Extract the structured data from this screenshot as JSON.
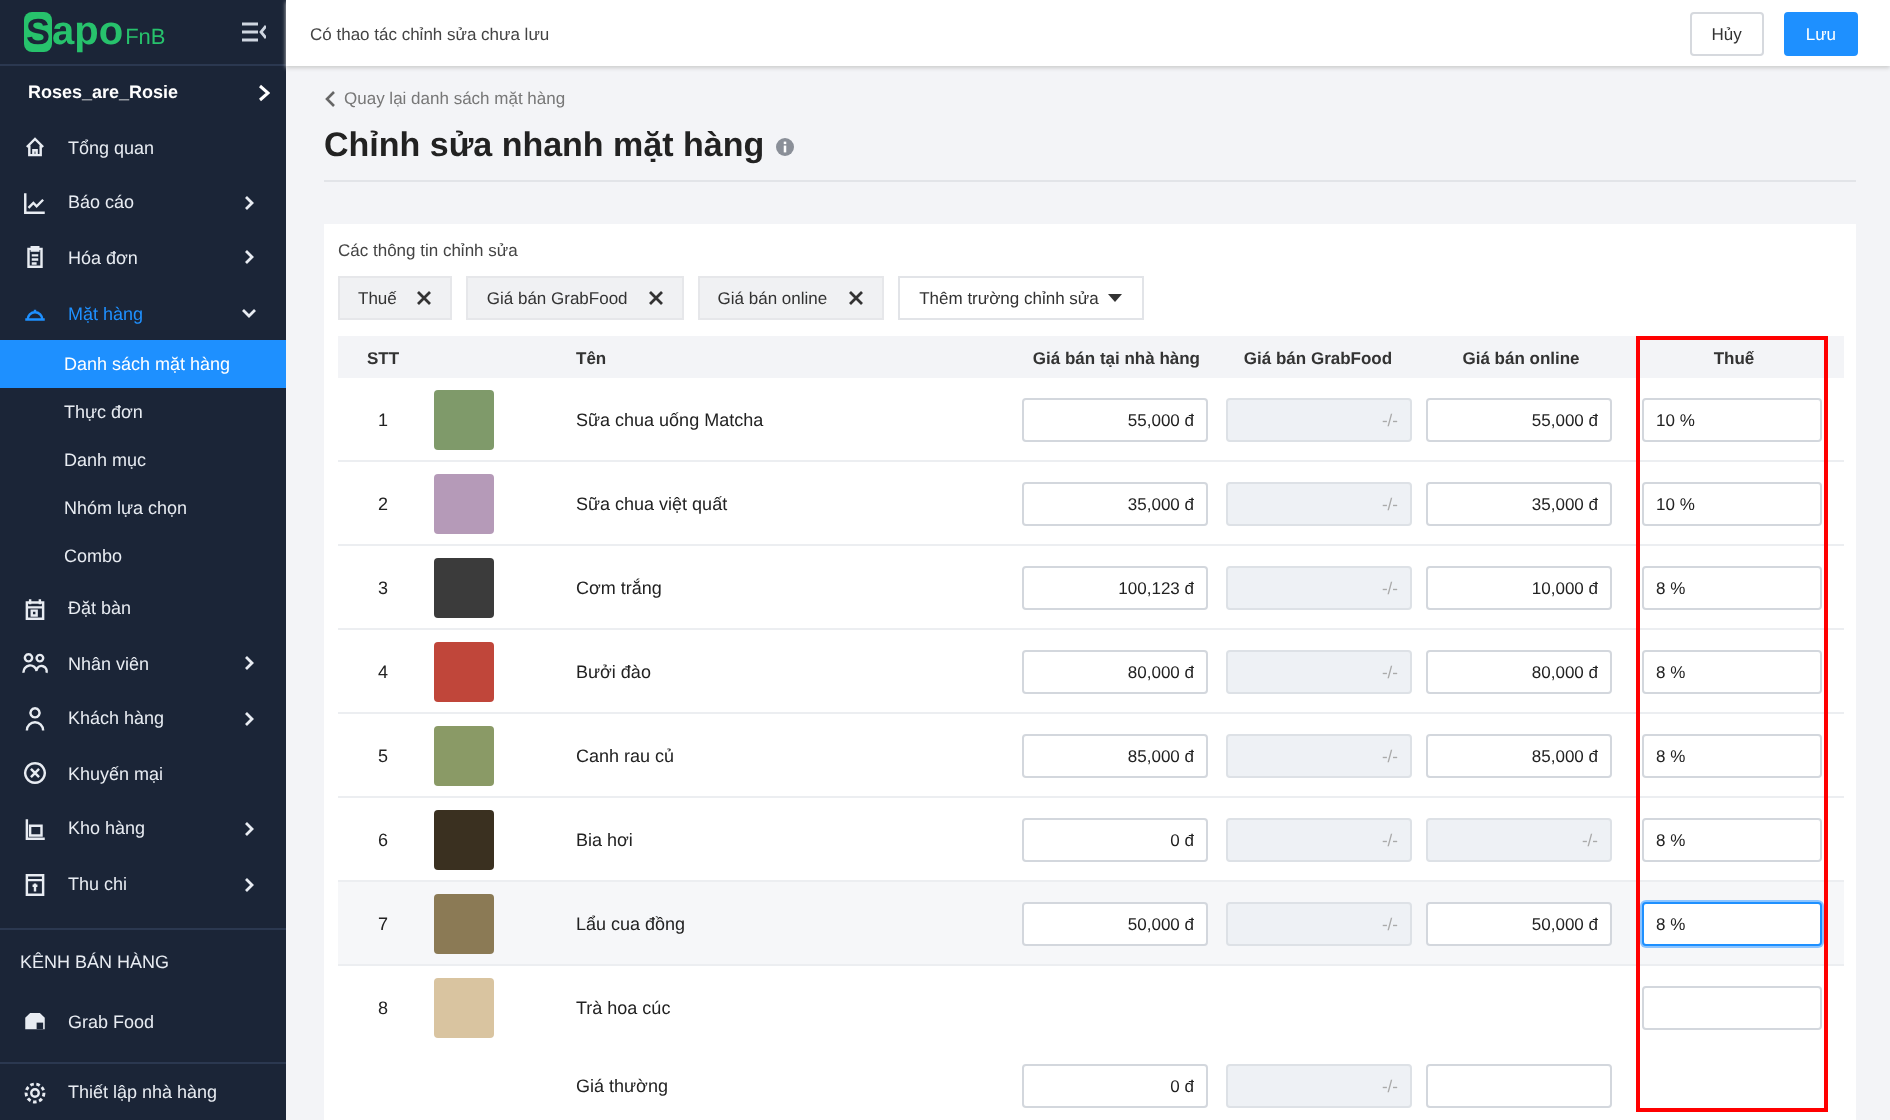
{
  "logo": {
    "badge": "S",
    "name": "apo",
    "suffix": "FnB"
  },
  "sidebar": {
    "account": "Roses_are_Rosie",
    "items": [
      {
        "label": "Tổng quan",
        "selected": false
      },
      {
        "label": "Báo cáo",
        "expanded": false,
        "selected": false
      },
      {
        "label": "Hóa đơn",
        "expanded": false,
        "selected": false
      },
      {
        "label": "Mặt hàng",
        "expanded": true,
        "selected": true,
        "children": [
          {
            "label": "Danh sách mặt hàng",
            "selected": true
          },
          {
            "label": "Thực đơn",
            "selected": false
          },
          {
            "label": "Danh mục",
            "selected": false
          },
          {
            "label": "Nhóm lựa chọn",
            "selected": false
          },
          {
            "label": "Combo",
            "selected": false
          }
        ]
      },
      {
        "label": "Đặt bàn",
        "selected": false
      },
      {
        "label": "Nhân viên",
        "expanded": false,
        "selected": false
      },
      {
        "label": "Khách hàng",
        "expanded": false,
        "selected": false
      },
      {
        "label": "Khuyến mại",
        "selected": false
      },
      {
        "label": "Kho hàng",
        "expanded": false,
        "selected": false
      },
      {
        "label": "Thu chi",
        "expanded": false,
        "selected": false
      }
    ],
    "section_title": "KÊNH BÁN HÀNG",
    "channels": [
      {
        "label": "Grab Food"
      }
    ],
    "footer_item": {
      "label": "Thiết lập nhà hàng"
    }
  },
  "topbar": {
    "message": "Có thao tác chỉnh sửa chưa lưu",
    "buttons": [
      {
        "label": "Hủy",
        "kind": "secondary"
      },
      {
        "label": "Lưu",
        "kind": "primary"
      }
    ]
  },
  "back_link": "Quay lại danh sách mặt hàng",
  "title": "Chỉnh sửa nhanh mặt hàng",
  "editor": {
    "caption": "Các thông tin chỉnh sửa",
    "chips": [
      "Thuế",
      "Giá bán GrabFood",
      "Giá bán online"
    ],
    "add_field_button": "Thêm trường chỉnh sửa",
    "columns": [
      {
        "label": "STT",
        "highlighted": false
      },
      {
        "label": "Tên",
        "highlighted": false
      },
      {
        "label": "Giá bán tại nhà hàng",
        "highlighted": false
      },
      {
        "label": "Giá bán GrabFood",
        "highlighted": false
      },
      {
        "label": "Giá bán online",
        "highlighted": false
      },
      {
        "label": "Thuế",
        "highlighted": true
      }
    ],
    "rows": [
      {
        "kind": "item",
        "stt": "1",
        "name": "Sữa chua uống Matcha",
        "hovered": false,
        "price": {
          "value": "55,000 đ",
          "disabled": false
        },
        "grab": {
          "placeholder": "-/-",
          "disabled": true
        },
        "online": {
          "value": "55,000 đ",
          "disabled": false
        },
        "tax": {
          "value": "10 %",
          "focused": false
        }
      },
      {
        "kind": "item",
        "stt": "2",
        "name": "Sữa chua việt quất",
        "hovered": false,
        "price": {
          "value": "35,000 đ",
          "disabled": false
        },
        "grab": {
          "placeholder": "-/-",
          "disabled": true
        },
        "online": {
          "value": "35,000 đ",
          "disabled": false
        },
        "tax": {
          "value": "10 %",
          "focused": false
        }
      },
      {
        "kind": "item",
        "stt": "3",
        "name": "Cơm trắng",
        "hovered": false,
        "price": {
          "value": "100,123 đ",
          "disabled": false
        },
        "grab": {
          "placeholder": "-/-",
          "disabled": true
        },
        "online": {
          "value": "10,000 đ",
          "disabled": false
        },
        "tax": {
          "value": "8 %",
          "focused": false
        }
      },
      {
        "kind": "item",
        "stt": "4",
        "name": "Bưởi đào",
        "hovered": false,
        "price": {
          "value": "80,000 đ",
          "disabled": false
        },
        "grab": {
          "placeholder": "-/-",
          "disabled": true
        },
        "online": {
          "value": "80,000 đ",
          "disabled": false
        },
        "tax": {
          "value": "8 %",
          "focused": false
        }
      },
      {
        "kind": "item",
        "stt": "5",
        "name": "Canh rau củ",
        "hovered": false,
        "price": {
          "value": "85,000 đ",
          "disabled": false
        },
        "grab": {
          "placeholder": "-/-",
          "disabled": true
        },
        "online": {
          "value": "85,000 đ",
          "disabled": false
        },
        "tax": {
          "value": "8 %",
          "focused": false
        }
      },
      {
        "kind": "item",
        "stt": "6",
        "name": "Bia hơi",
        "hovered": false,
        "price": {
          "value": "0 đ",
          "disabled": false
        },
        "grab": {
          "placeholder": "-/-",
          "disabled": true
        },
        "online": {
          "placeholder": "-/-",
          "disabled": true
        },
        "tax": {
          "value": "8 %",
          "focused": false
        }
      },
      {
        "kind": "item",
        "stt": "7",
        "name": "Lẩu cua đồng",
        "hovered": true,
        "price": {
          "value": "50,000 đ",
          "disabled": false
        },
        "grab": {
          "placeholder": "-/-",
          "disabled": true
        },
        "online": {
          "value": "50,000 đ",
          "disabled": false
        },
        "tax": {
          "value": "8 %",
          "focused": true
        }
      },
      {
        "kind": "group",
        "stt": "8",
        "name": "Trà hoa cúc",
        "hovered": false,
        "tax": {
          "focused": false
        }
      },
      {
        "kind": "variant",
        "name": "Giá thường",
        "hovered": false,
        "price": {
          "value": "0 đ",
          "disabled": false
        },
        "grab": {
          "placeholder": "-/-",
          "disabled": true
        },
        "online": {
          "disabled": false
        }
      }
    ]
  }
}
